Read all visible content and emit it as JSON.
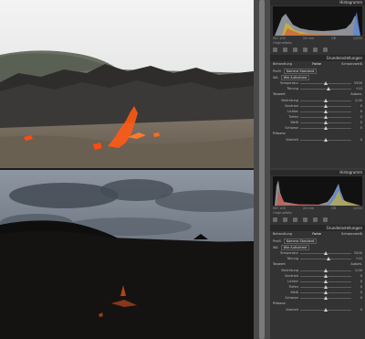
{
  "panels": [
    {
      "histogram_title": "Histogramm",
      "meta": [
        "ISO 100",
        "24 mm",
        "f/8",
        "1/250"
      ],
      "original_label": "Originalfoto",
      "section_title": "Grundeinstellungen",
      "treatment": {
        "label": "Behandlung",
        "color": "Farbe",
        "bw": "Schwarzweiß"
      },
      "profile": {
        "label": "Profil",
        "value": "Kamera Standard"
      },
      "wb": {
        "label": "WA",
        "value": "Wie Aufnahme"
      },
      "tone_label": "Tonwert",
      "tone_auto": "Autom.",
      "sliders": [
        {
          "label": "Temperatur",
          "pos": 0.5,
          "value": "5500"
        },
        {
          "label": "Tönung",
          "pos": 0.55,
          "value": "+10"
        },
        {
          "label": "Belichtung",
          "pos": 0.5,
          "value": "0,00"
        },
        {
          "label": "Kontrast",
          "pos": 0.5,
          "value": "0"
        },
        {
          "label": "Lichter",
          "pos": 0.5,
          "value": "0"
        },
        {
          "label": "Tiefen",
          "pos": 0.5,
          "value": "0"
        },
        {
          "label": "Weiß",
          "pos": 0.5,
          "value": "0"
        },
        {
          "label": "Schwarz",
          "pos": 0.5,
          "value": "0"
        }
      ],
      "presence_label": "Präsenz",
      "presence": [
        {
          "label": "Klarheit",
          "pos": 0.5,
          "value": "0"
        }
      ]
    },
    {
      "histogram_title": "Histogramm",
      "meta": [
        "ISO 100",
        "24 mm",
        "f/8",
        "1/250"
      ],
      "original_label": "Originalfoto",
      "section_title": "Grundeinstellungen",
      "treatment": {
        "label": "Behandlung",
        "color": "Farbe",
        "bw": "Schwarzweiß"
      },
      "profile": {
        "label": "Profil",
        "value": "Kamera Standard"
      },
      "wb": {
        "label": "WA",
        "value": "Wie Aufnahme"
      },
      "tone_label": "Tonwert",
      "tone_auto": "Autom.",
      "sliders": [
        {
          "label": "Temperatur",
          "pos": 0.5,
          "value": "5500"
        },
        {
          "label": "Tönung",
          "pos": 0.55,
          "value": "+10"
        },
        {
          "label": "Belichtung",
          "pos": 0.5,
          "value": "0,00"
        },
        {
          "label": "Kontrast",
          "pos": 0.5,
          "value": "0"
        },
        {
          "label": "Lichter",
          "pos": 0.5,
          "value": "0"
        },
        {
          "label": "Tiefen",
          "pos": 0.5,
          "value": "0"
        },
        {
          "label": "Weiß",
          "pos": 0.5,
          "value": "0"
        },
        {
          "label": "Schwarz",
          "pos": 0.5,
          "value": "0"
        }
      ],
      "presence_label": "Präsenz",
      "presence": [
        {
          "label": "Klarheit",
          "pos": 0.5,
          "value": "0"
        }
      ]
    }
  ],
  "colors": {
    "lava": "#ff5a14",
    "panel_bg": "#333333",
    "histogram_bg": "#111111"
  },
  "icons": [
    "crop-icon",
    "spot-removal-icon",
    "red-eye-icon",
    "graduated-filter-icon",
    "radial-filter-icon",
    "brush-icon"
  ]
}
